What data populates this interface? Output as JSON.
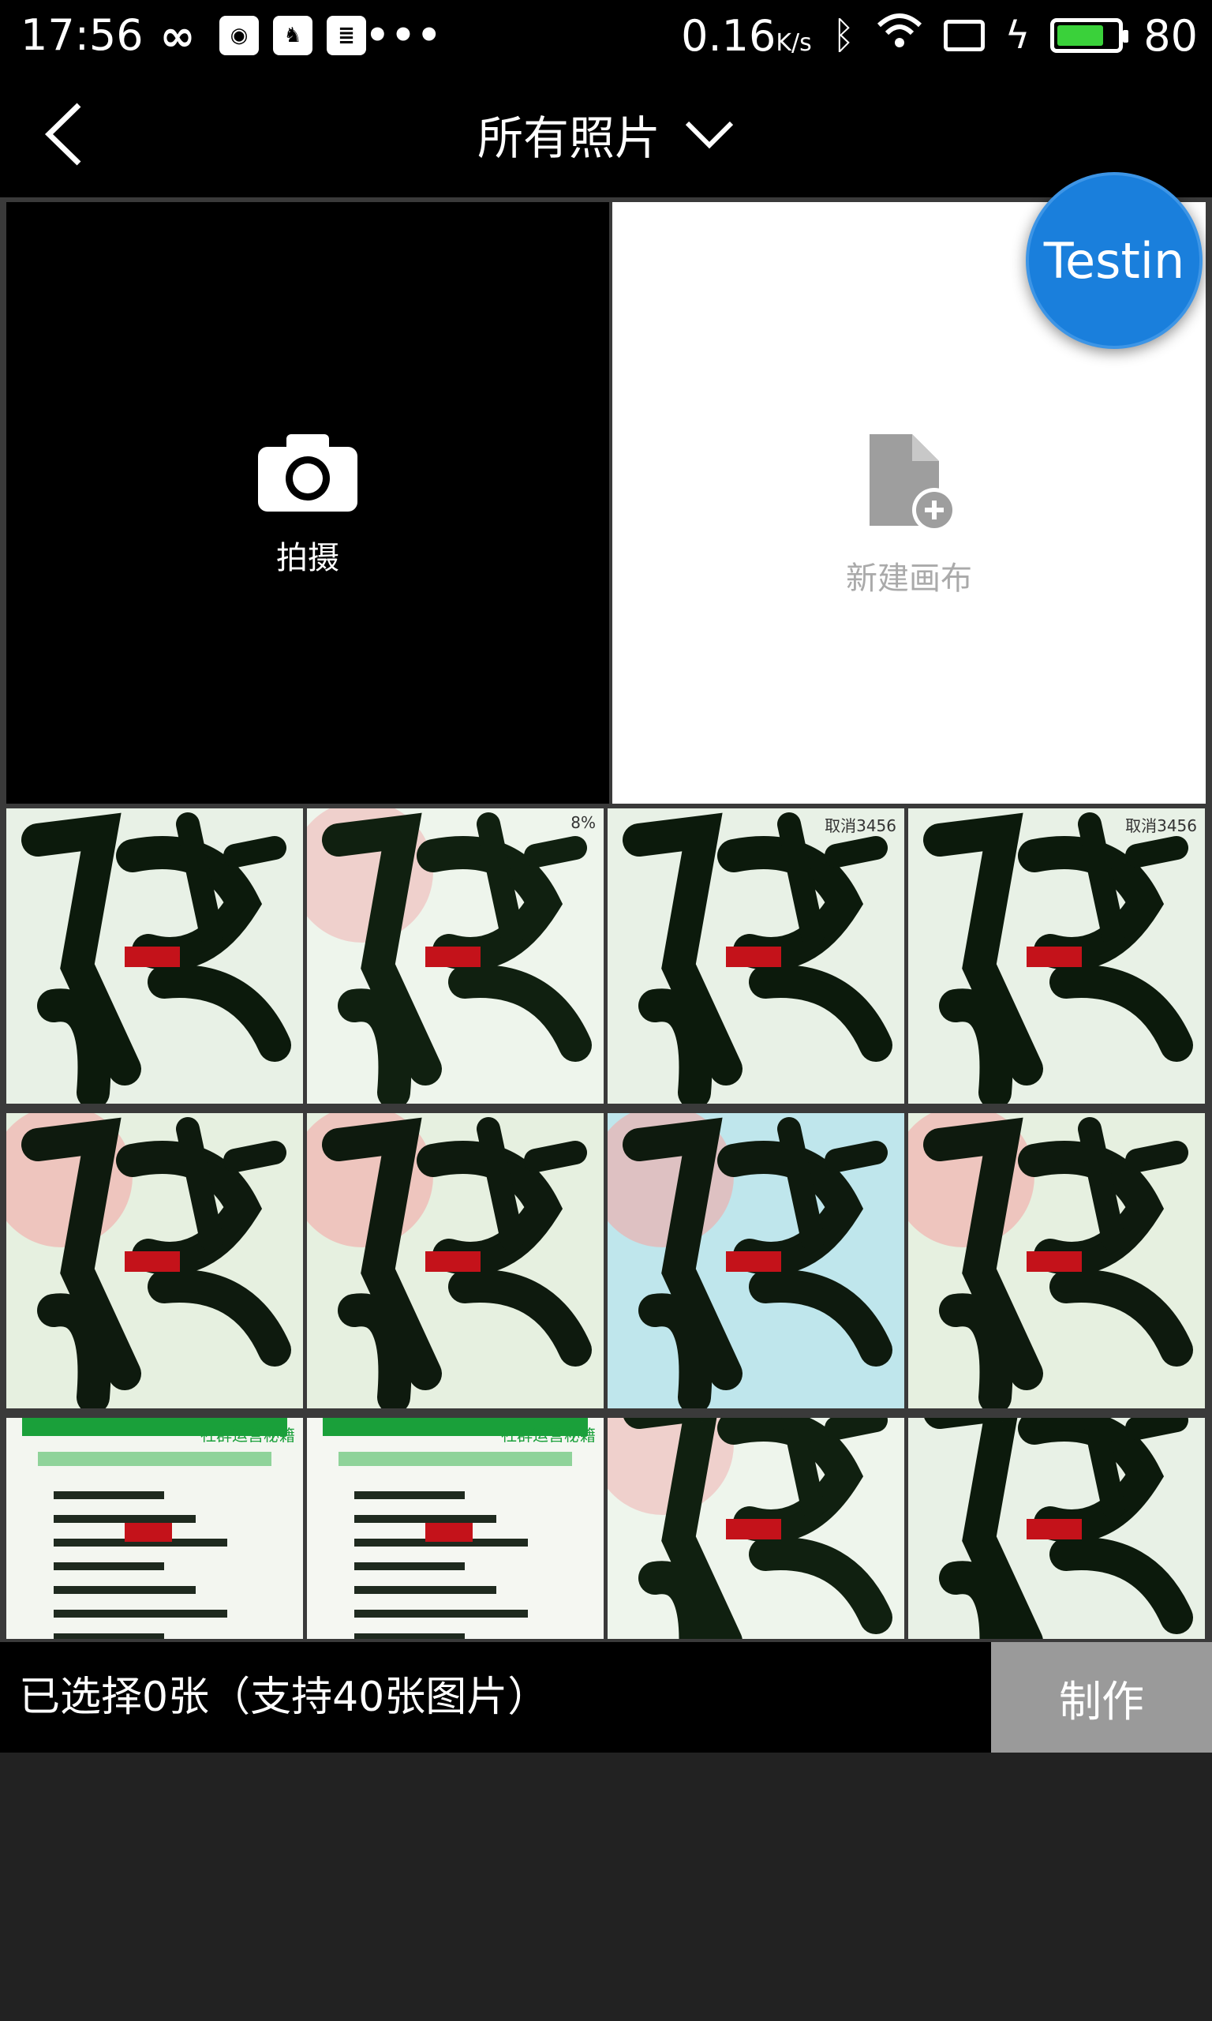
{
  "status_bar": {
    "time": "17:56",
    "left_icons": [
      "loop-icon",
      "weibo-icon",
      "uc-browser-icon",
      "news-icon",
      "more-dots-icon"
    ],
    "speed_value": "0.16",
    "speed_unit": "K/s",
    "battery_level": 80,
    "battery_text": "80",
    "battery_color": "#3ad13a"
  },
  "header": {
    "back_icon": "chevron-left-icon",
    "title": "所有照片",
    "dropdown_icon": "chevron-down-icon"
  },
  "tiles": {
    "camera": {
      "label": "拍摄",
      "icon": "camera-icon"
    },
    "new_canvas": {
      "label": "新建画布",
      "icon": "file-add-icon"
    }
  },
  "photos": [
    {
      "style": "calligraphy-dark",
      "text": ""
    },
    {
      "style": "calligraphy-light",
      "text": "8%"
    },
    {
      "style": "calligraphy-dark",
      "text": "取消3456"
    },
    {
      "style": "calligraphy-dark",
      "text": "取消3456"
    },
    {
      "style": "calligraphy-pink",
      "text": ""
    },
    {
      "style": "calligraphy-pink",
      "text": ""
    },
    {
      "style": "calligraphy-blue",
      "text": ""
    },
    {
      "style": "calligraphy-pink",
      "text": ""
    },
    {
      "style": "poster-green",
      "text": "社群运营秘籍"
    },
    {
      "style": "poster-white",
      "text": "社群运营秘籍"
    },
    {
      "style": "calligraphy-light",
      "text": ""
    },
    {
      "style": "calligraphy-dark",
      "text": ""
    }
  ],
  "footer": {
    "selection_text": "已选择0张（支持40张图片）",
    "make_label": "制作"
  },
  "overlay": {
    "badge_text": "Testin",
    "badge_color": "#1a7fdc"
  }
}
